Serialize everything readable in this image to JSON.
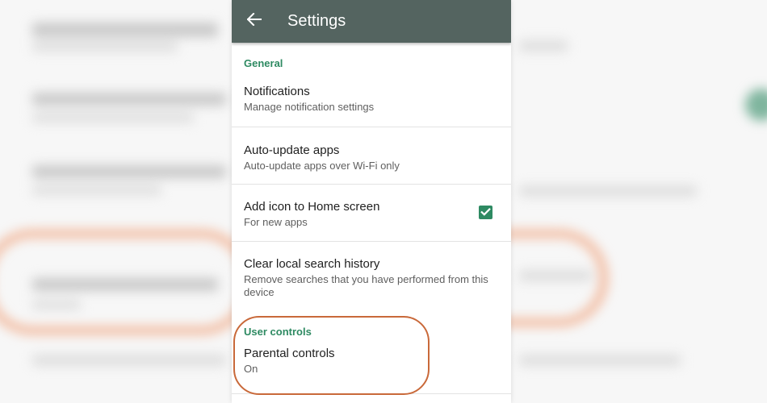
{
  "appbar": {
    "title": "Settings",
    "back_icon": "arrow-back-icon"
  },
  "sections": {
    "general": "General",
    "user_controls": "User controls"
  },
  "items": {
    "notifications": {
      "title": "Notifications",
      "subtitle": "Manage notification settings"
    },
    "auto_update": {
      "title": "Auto-update apps",
      "subtitle": "Auto-update apps over Wi-Fi only"
    },
    "add_icon": {
      "title": "Add icon to Home screen",
      "subtitle": "For new apps",
      "checked": true
    },
    "clear_history": {
      "title": "Clear local search history",
      "subtitle": "Remove searches that you have performed from this device"
    },
    "parental": {
      "title": "Parental controls",
      "subtitle": "On"
    }
  },
  "colors": {
    "appbar": "#546460",
    "accent": "#2e8a62",
    "highlight_ring": "#c9693a"
  }
}
